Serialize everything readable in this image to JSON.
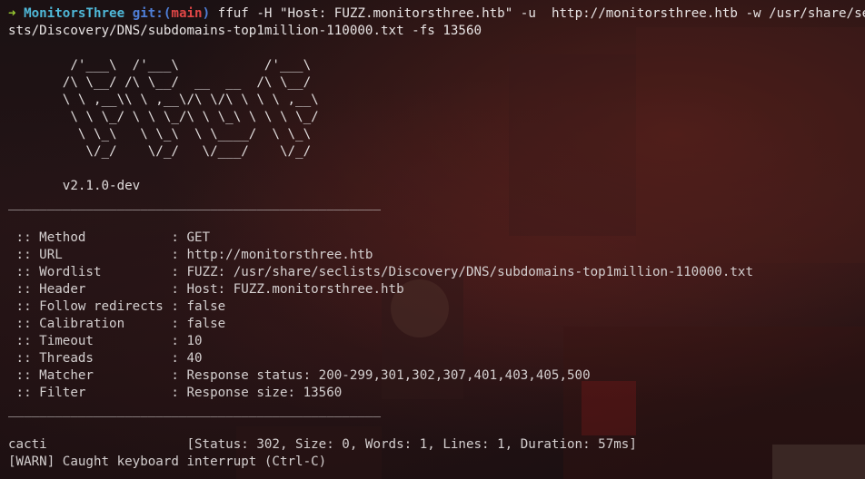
{
  "prompt": {
    "arrow": "➜",
    "directory": "MonitorsThree",
    "git_label": "git:(",
    "branch": "main",
    "git_close": ")",
    "command_line1": " ffuf -H \"Host: FUZZ.monitorsthree.htb\" -u  http://monitorsthree.htb -w /usr/share/secli",
    "command_line2": "sts/Discovery/DNS/subdomains-top1million-110000.txt -fs 13560"
  },
  "banner": [
    "        /'___\\  /'___\\           /'___\\",
    "       /\\ \\__/ /\\ \\__/  __  __  /\\ \\__/",
    "       \\ \\ ,__\\\\ \\ ,__\\/\\ \\/\\ \\ \\ \\ ,__\\",
    "        \\ \\ \\_/ \\ \\ \\_/\\ \\ \\_\\ \\ \\ \\ \\_/",
    "         \\ \\_\\   \\ \\_\\  \\ \\____/  \\ \\_\\",
    "          \\/_/    \\/_/   \\/___/    \\/_/"
  ],
  "version": "       v2.1.0-dev",
  "separator": "________________________________________________",
  "config": [
    {
      "key": " :: Method           ",
      "value": ": GET"
    },
    {
      "key": " :: URL              ",
      "value": ": http://monitorsthree.htb"
    },
    {
      "key": " :: Wordlist         ",
      "value": ": FUZZ: /usr/share/seclists/Discovery/DNS/subdomains-top1million-110000.txt"
    },
    {
      "key": " :: Header           ",
      "value": ": Host: FUZZ.monitorsthree.htb"
    },
    {
      "key": " :: Follow redirects ",
      "value": ": false"
    },
    {
      "key": " :: Calibration      ",
      "value": ": false"
    },
    {
      "key": " :: Timeout          ",
      "value": ": 10"
    },
    {
      "key": " :: Threads          ",
      "value": ": 40"
    },
    {
      "key": " :: Matcher          ",
      "value": ": Response status: 200-299,301,302,307,401,403,405,500"
    },
    {
      "key": " :: Filter           ",
      "value": ": Response size: 13560"
    }
  ],
  "result": {
    "word": "cacti",
    "details": "                  [Status: 302, Size: 0, Words: 1, Lines: 1, Duration: 57ms]"
  },
  "warning": "[WARN] Caught keyboard interrupt (Ctrl-C)"
}
